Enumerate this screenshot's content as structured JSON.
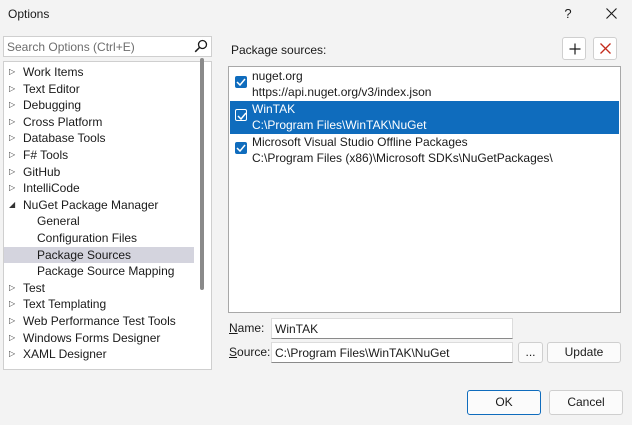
{
  "window": {
    "title": "Options",
    "help_label": "?"
  },
  "search": {
    "placeholder": "Search Options (Ctrl+E)",
    "value": ""
  },
  "tree": {
    "items": [
      {
        "label": "Work Items",
        "expandable": true
      },
      {
        "label": "Text Editor",
        "expandable": true
      },
      {
        "label": "Debugging",
        "expandable": true
      },
      {
        "label": "Cross Platform",
        "expandable": true
      },
      {
        "label": "Database Tools",
        "expandable": true
      },
      {
        "label": "F# Tools",
        "expandable": true
      },
      {
        "label": "GitHub",
        "expandable": true
      },
      {
        "label": "IntelliCode",
        "expandable": true
      },
      {
        "label": "NuGet Package Manager",
        "expanded": true
      },
      {
        "label": "General",
        "child": true
      },
      {
        "label": "Configuration Files",
        "child": true
      },
      {
        "label": "Package Sources",
        "child": true,
        "selected": true
      },
      {
        "label": "Package Source Mapping",
        "child": true
      },
      {
        "label": "Test",
        "expandable": true
      },
      {
        "label": "Text Templating",
        "expandable": true
      },
      {
        "label": "Web Performance Test Tools",
        "expandable": true
      },
      {
        "label": "Windows Forms Designer",
        "expandable": true
      },
      {
        "label": "XAML Designer",
        "expandable": true
      }
    ]
  },
  "package_sources": {
    "heading": "Package sources:",
    "sources": [
      {
        "name": "nuget.org",
        "path": "https://api.nuget.org/v3/index.json",
        "checked": true,
        "selected": false
      },
      {
        "name": "WinTAK",
        "path": "C:\\Program Files\\WinTAK\\NuGet",
        "checked": true,
        "selected": true
      },
      {
        "name": "Microsoft Visual Studio Offline Packages",
        "path": "C:\\Program Files (x86)\\Microsoft SDKs\\NuGetPackages\\",
        "checked": true,
        "selected": false
      }
    ]
  },
  "form": {
    "name_label_accel": "N",
    "name_label_rest": "ame:",
    "name_value": "WinTAK",
    "source_label_accel": "S",
    "source_label_rest": "ource:",
    "source_value": "C:\\Program Files\\WinTAK\\NuGet",
    "browse_label": "...",
    "update_label": "Update"
  },
  "footer": {
    "ok_label": "OK",
    "cancel_label": "Cancel"
  },
  "colors": {
    "accent": "#0f6cbd",
    "tree_selection": "#d4d4de",
    "remove_icon": "#c42b1c"
  }
}
